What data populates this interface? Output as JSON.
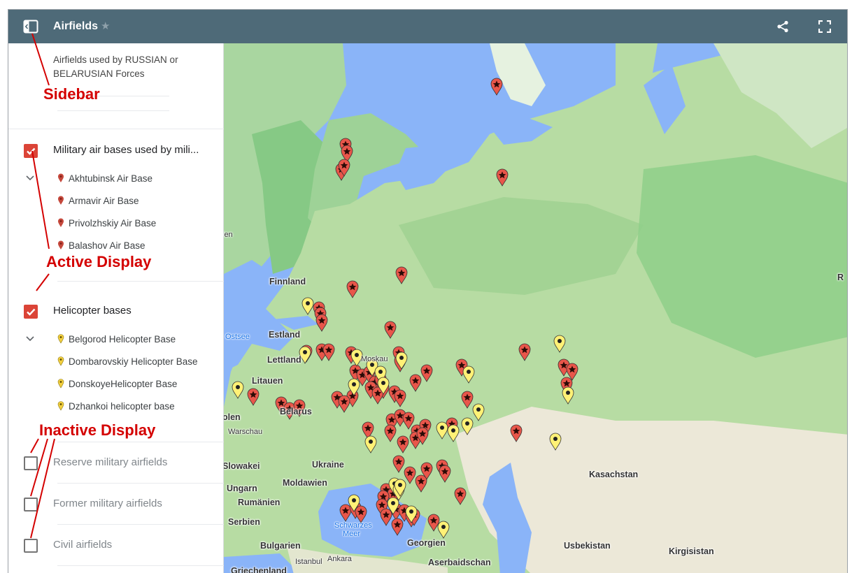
{
  "header": {
    "title": "Airfields",
    "star_glyph": "★",
    "sidebar_icon": "sidebar-toggle-icon",
    "share_icon": "share-icon",
    "fullscreen_icon": "fullscreen-icon",
    "bar_color": "#4e6a78"
  },
  "sidebar": {
    "description": "Airfields used by RUSSIAN or BELARUSIAN Forces",
    "layers": [
      {
        "title": "Military air bases used by mili...",
        "checked": true,
        "items": [
          "Akhtubinsk Air Base",
          "Armavir Air Base",
          "Privolzhskiy Air Base",
          "Balashov Air Base"
        ]
      },
      {
        "title": "Helicopter bases",
        "checked": true,
        "items": [
          "Belgorod Helicopter Base",
          "Dombarovskiy Helicopter Base",
          "DonskoyeHelicopter Base",
          "Dzhankoi helicopter base"
        ]
      },
      {
        "title": "Reserve military airfields",
        "checked": false
      },
      {
        "title": "Former military airfields",
        "checked": false
      },
      {
        "title": "Civil airfields",
        "checked": false
      }
    ],
    "check_color": "#db4437"
  },
  "map": {
    "labels": {
      "finnland": "Finnland",
      "estland": "Estland",
      "lettland": "Lettland",
      "litauen": "Litauen",
      "belarus": "Belarus",
      "polen": "olen",
      "warschau": "Warschau",
      "ukraine": "Ukraine",
      "moldawien": "Moldawien",
      "slowakei": "Slowakei",
      "ungarn": "Ungarn",
      "rumaenien": "Rumänien",
      "serbien": "Serbien",
      "bulgarien": "Bulgarien",
      "griechenland": "Griechenland",
      "istanbul": "Istanbul",
      "ankara": "Ankara",
      "georgien": "Georgien",
      "aserbaidschan": "Aserbaidschan",
      "kasachstan": "Kasachstan",
      "usbekistan": "Usbekistan",
      "kirgisistan": "Kirgisistan",
      "ostsee": "Ostsee",
      "schwarzes": "Schwarzes",
      "meer": "Meer",
      "moskau": "Moskau",
      "schweden_frag": "len",
      "r_frag": "R"
    },
    "colors": {
      "water": "#8ab4f8",
      "land": "#b7dca3",
      "forest": "#8fcf8a",
      "steppe": "#ece8d8",
      "red_pin": "#e8564a",
      "yellow_pin": "#fff176"
    }
  },
  "annotations": {
    "sidebar": "Sidebar",
    "active": "Active Display",
    "inactive": "Inactive Display",
    "color": "#d40000"
  }
}
